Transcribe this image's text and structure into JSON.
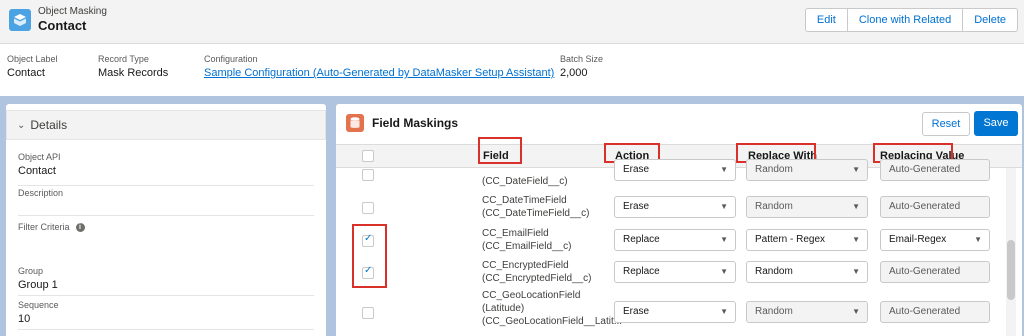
{
  "header": {
    "object_type": "Object Masking",
    "record_name": "Contact",
    "icon": "object-masking-icon",
    "buttons": {
      "edit": "Edit",
      "clone": "Clone with Related",
      "delete": "Delete"
    }
  },
  "highlights": [
    {
      "label": "Object Label",
      "value": "Contact"
    },
    {
      "label": "Record Type",
      "value": "Mask Records"
    },
    {
      "label": "Configuration",
      "value": "Sample Configuration (Auto-Generated by DataMasker Setup Assistant)"
    },
    {
      "label": "Batch Size",
      "value": "2,000"
    }
  ],
  "details": {
    "section_title": "Details",
    "object_api_label": "Object API",
    "object_api_value": "Contact",
    "description_label": "Description",
    "filter_label": "Filter Criteria",
    "group_label": "Group",
    "group_value": "Group 1",
    "sequence_label": "Sequence",
    "sequence_value": "10"
  },
  "field_maskings": {
    "title": "Field Maskings",
    "reset_label": "Reset",
    "save_label": "Save",
    "columns": {
      "field": "Field",
      "action": "Action",
      "replace_with": "Replace With",
      "replacing_value": "Replacing Value"
    },
    "rows": [
      {
        "field_line1": "(CC_DateField__c)",
        "field_line2": "",
        "field_line3": "",
        "checked": false,
        "action": "Erase",
        "replace_with": "Random",
        "replacing_value": "Auto-Generated"
      },
      {
        "field_line1": "CC_DateTimeField",
        "field_line2": "(CC_DateTimeField__c)",
        "field_line3": "",
        "checked": false,
        "action": "Erase",
        "replace_with": "Random",
        "replacing_value": "Auto-Generated"
      },
      {
        "field_line1": "CC_EmailField",
        "field_line2": "(CC_EmailField__c)",
        "field_line3": "",
        "checked": true,
        "action": "Replace",
        "replace_with": "Pattern - Regex",
        "replacing_value": "Email-Regex"
      },
      {
        "field_line1": "CC_EncryptedField",
        "field_line2": "(CC_EncryptedField__c)",
        "field_line3": "",
        "checked": true,
        "action": "Replace",
        "replace_with": "Random",
        "replacing_value": "Auto-Generated"
      },
      {
        "field_line1": "CC_GeoLocationField",
        "field_line2": "(Latitude)",
        "field_line3": "(CC_GeoLocationField__Latit...",
        "checked": false,
        "action": "Erase",
        "replace_with": "Random",
        "replacing_value": "Auto-Generated"
      }
    ]
  },
  "colors": {
    "brand": "#0176d3",
    "highlight_box": "#d9302a",
    "object_icon": "#4ba3e4",
    "masking_icon": "#e3734e"
  }
}
